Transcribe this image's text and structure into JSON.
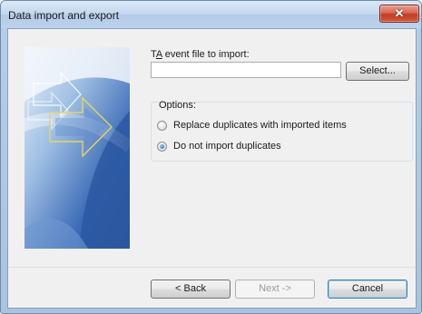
{
  "window": {
    "title": "Data import and export"
  },
  "form": {
    "file_label_prefix": "T",
    "file_label_mnemonic": "A",
    "file_label_rest": " event file to import:",
    "file_value": "",
    "select_label": "Select..."
  },
  "options": {
    "legend": "Options:",
    "items": [
      {
        "label": "Replace duplicates with imported items",
        "checked": false
      },
      {
        "label": "Do not import duplicates",
        "checked": true
      }
    ]
  },
  "footer": {
    "back_label": "< Back",
    "next_label": "Next ->",
    "cancel_label": "Cancel"
  },
  "colors": {
    "banner": "#3f6fb9",
    "accent": "#1e5d9e"
  }
}
